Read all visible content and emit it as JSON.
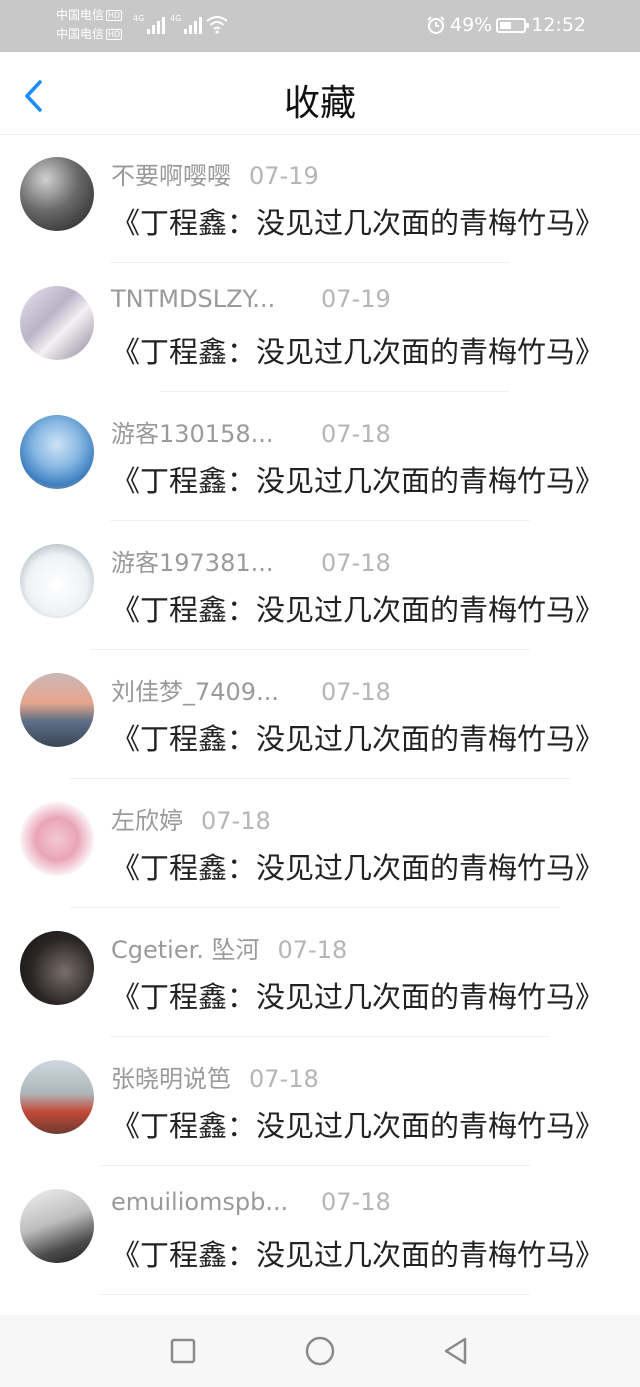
{
  "status_bar": {
    "carrier_1": "中国电信",
    "carrier_2": "中国电信",
    "hd_badge": "HD",
    "network_type": "4G",
    "battery_percent": "49%",
    "battery_level": 0.49,
    "time": "12:52",
    "icons": [
      "signal-icon",
      "wifi-icon",
      "alarm-icon",
      "battery-icon"
    ]
  },
  "header": {
    "title": "收藏",
    "back_icon": "chevron-left-icon",
    "accent_color": "#1a8cff"
  },
  "items": [
    {
      "name": "不要啊嘤嘤",
      "date": "07-19",
      "message": "《丁程鑫：没见过几次面的青梅竹马》"
    },
    {
      "name": "TNTMDSLZY...",
      "date": "07-19",
      "message": "《丁程鑫：没见过几次面的青梅竹马》"
    },
    {
      "name": "游客130158...",
      "date": "07-18",
      "message": "《丁程鑫：没见过几次面的青梅竹马》"
    },
    {
      "name": "游客197381...",
      "date": "07-18",
      "message": "《丁程鑫：没见过几次面的青梅竹马》"
    },
    {
      "name": "刘佳梦_7409...",
      "date": "07-18",
      "message": "《丁程鑫：没见过几次面的青梅竹马》"
    },
    {
      "name": "左欣婷",
      "date": "07-18",
      "message": "《丁程鑫：没见过几次面的青梅竹马》"
    },
    {
      "name": "Cgetier. 坠河",
      "date": "07-18",
      "message": "《丁程鑫：没见过几次面的青梅竹马》"
    },
    {
      "name": "张晓明说笆",
      "date": "07-18",
      "message": "《丁程鑫：没见过几次面的青梅竹马》"
    },
    {
      "name": "emuiliomspb...",
      "date": "07-18",
      "message": "《丁程鑫：没见过几次面的青梅竹马》"
    }
  ],
  "nav_bar": {
    "icons": [
      "recent-apps-icon",
      "home-icon",
      "back-triangle-icon"
    ]
  }
}
